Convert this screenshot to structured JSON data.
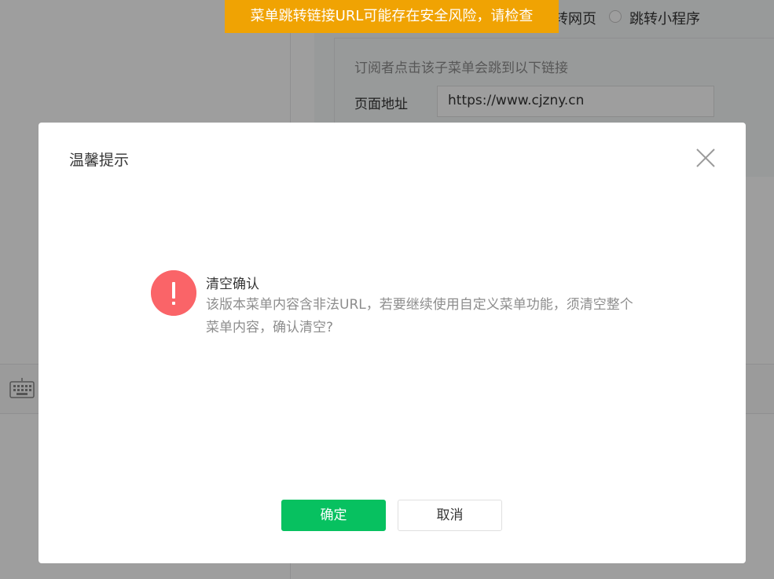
{
  "banner": {
    "text": "菜单跳转链接URL可能存在安全风险，请检查"
  },
  "background": {
    "radio_webpage_label": "转网页",
    "radio_miniprogram_label": "跳转小程序",
    "link_tip": "订阅者点击该子菜单会跳到以下链接",
    "url_label": "页面地址",
    "url_value": "https://www.cjzny.cn"
  },
  "dialog": {
    "title": "温馨提示",
    "message_title": "清空确认",
    "message_desc": "该版本菜单内容含非法URL，若要继续使用自定义菜单功能，须清空整个菜单内容，确认清空?",
    "confirm_label": "确定",
    "cancel_label": "取消"
  },
  "icons": {
    "close": "close-icon",
    "warning": "exclamation-icon",
    "keyboard": "keyboard-icon"
  },
  "colors": {
    "banner": "#f0a303",
    "confirm": "#07c160",
    "warning": "#fa6468"
  }
}
